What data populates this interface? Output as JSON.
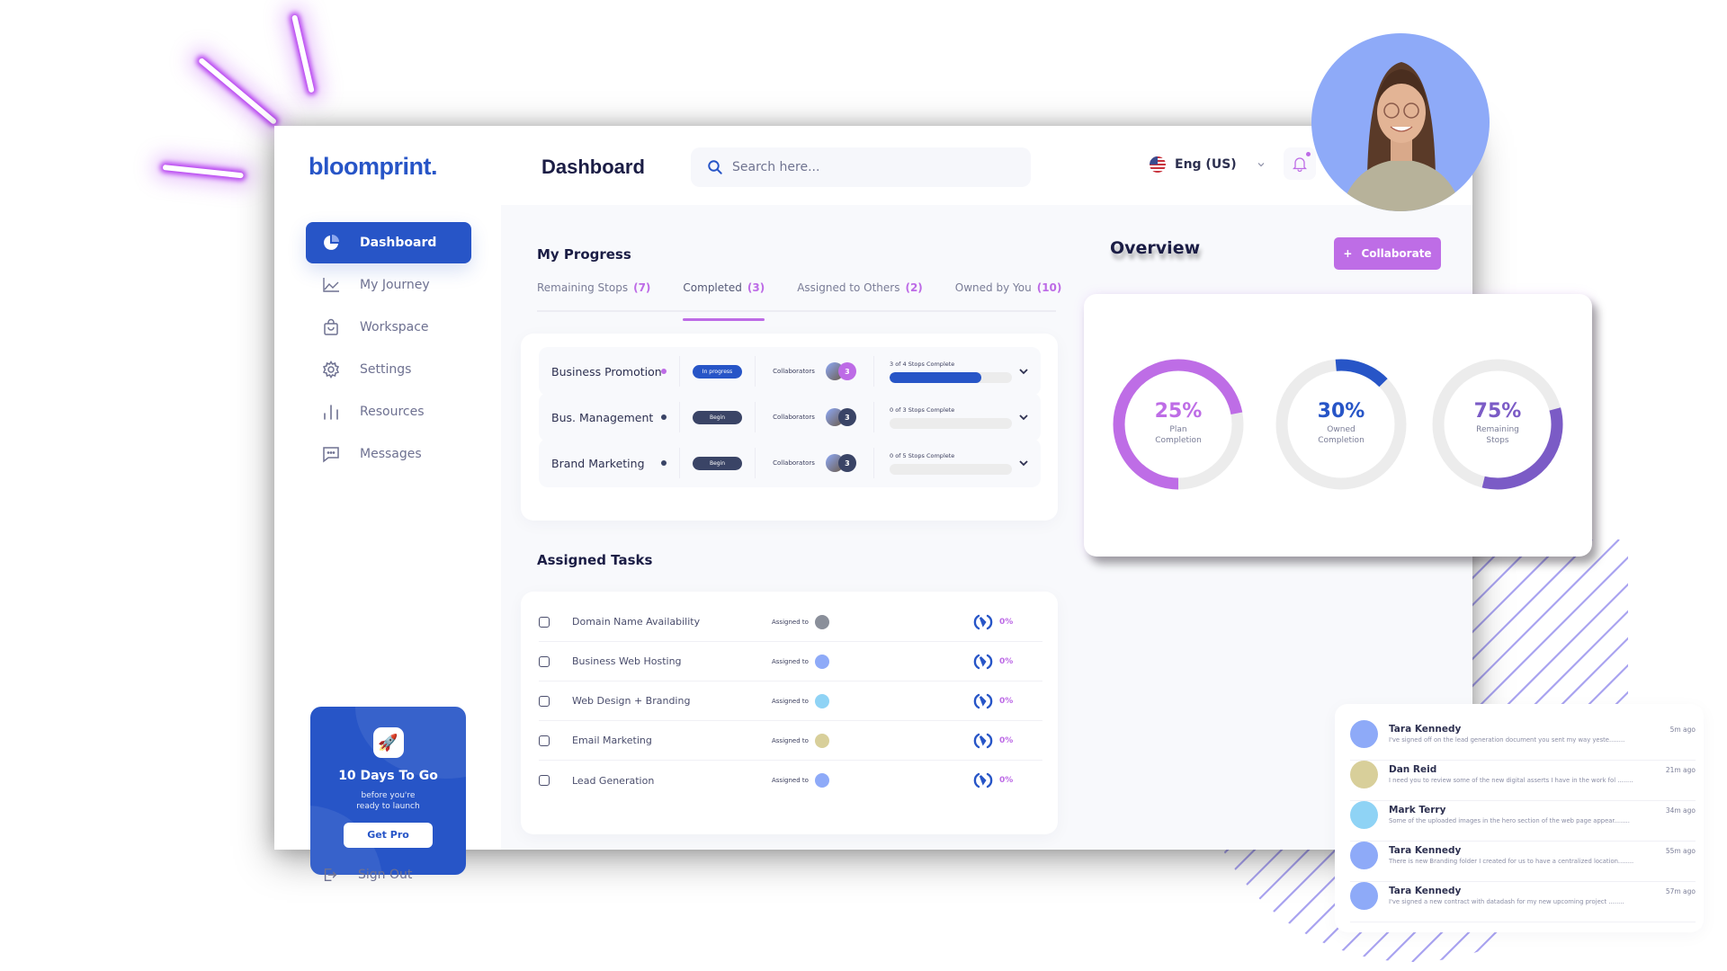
{
  "brand": {
    "name": "bloomprint.",
    "primary_color": "#2755c7",
    "accent_color": "#be6de6"
  },
  "header": {
    "title": "Dashboard",
    "search_placeholder": "Search here...",
    "language": "Eng (US)",
    "language_icon": "us-flag-icon",
    "notification_icon": "bell-icon"
  },
  "sidebar": {
    "items": [
      {
        "label": "Dashboard",
        "icon": "pie-chart-icon",
        "active": true
      },
      {
        "label": "My Journey",
        "icon": "line-chart-icon",
        "active": false
      },
      {
        "label": "Workspace",
        "icon": "shopping-bag-icon",
        "active": false
      },
      {
        "label": "Settings",
        "icon": "gear-icon",
        "active": false
      },
      {
        "label": "Resources",
        "icon": "bar-chart-icon",
        "active": false
      },
      {
        "label": "Messages",
        "icon": "message-icon",
        "active": false
      }
    ],
    "promo": {
      "icon": "rocket-icon",
      "title": "10 Days To Go",
      "subtitle_line1": "before you're",
      "subtitle_line2": "ready to launch",
      "button": "Get Pro"
    },
    "sign_out": "Sign Out"
  },
  "progress": {
    "title": "My Progress",
    "tabs": [
      {
        "label": "Remaining Stops",
        "count": "(7)",
        "active": false
      },
      {
        "label": "Completed",
        "count": "(3)",
        "active": true
      },
      {
        "label": "Assigned to Others",
        "count": "(2)",
        "active": false
      },
      {
        "label": "Owned by You",
        "count": "(10)",
        "active": false
      }
    ],
    "rows": [
      {
        "name": "Business Promotion",
        "dot_color": "#bd6be6",
        "status": "In progress",
        "status_color": "#2755c7",
        "collaborators_label": "Collaborators",
        "collaborator_count": "3",
        "count_color": "#bd6be6",
        "stops_label": "3 of 4 Stops Complete",
        "progress": 0.75
      },
      {
        "name": "Bus. Management",
        "dot_color": "#3a4466",
        "status": "Begin",
        "status_color": "#3a4466",
        "collaborators_label": "Collaborators",
        "collaborator_count": "3",
        "count_color": "#3a4466",
        "stops_label": "0 of 3 Stops Complete",
        "progress": 0
      },
      {
        "name": "Brand Marketing",
        "dot_color": "#3a4466",
        "status": "Begin",
        "status_color": "#3a4466",
        "collaborators_label": "Collaborators",
        "collaborator_count": "3",
        "count_color": "#3a4466",
        "stops_label": "0 of 5 Stops Complete",
        "progress": 0
      }
    ]
  },
  "tasks": {
    "title": "Assigned Tasks",
    "rows": [
      {
        "name": "Domain Name Availability",
        "assigned_label": "Assigned to",
        "avatar_color": "#8a8f9a",
        "percent": "0%"
      },
      {
        "name": "Business Web Hosting",
        "assigned_label": "Assigned to",
        "avatar_color": "#8eaaf8",
        "percent": "0%"
      },
      {
        "name": "Web Design + Branding",
        "assigned_label": "Assigned to",
        "avatar_color": "#8fd3f5",
        "percent": "0%"
      },
      {
        "name": "Email Marketing",
        "assigned_label": "Assigned to",
        "avatar_color": "#d8cf9a",
        "percent": "0%"
      },
      {
        "name": "Lead Generation",
        "assigned_label": "Assigned to",
        "avatar_color": "#8eaaf8",
        "percent": "0%"
      }
    ]
  },
  "overview": {
    "title": "Overview",
    "collaborate_button": "Collaborate",
    "stats": [
      {
        "value": "25%",
        "label_line1": "Plan",
        "label_line2": "Completion",
        "color": "#be6de6",
        "arc_fraction": 0.72,
        "arc_start_deg": 180
      },
      {
        "value": "30%",
        "label_line1": "Owned",
        "label_line2": "Completion",
        "color": "#2755c7",
        "arc_fraction": 0.14,
        "arc_start_deg": -5
      },
      {
        "value": "75%",
        "label_line1": "Remaining",
        "label_line2": "Stops",
        "color": "#7b5bc6",
        "arc_fraction": 0.33,
        "arc_start_deg": 75
      }
    ]
  },
  "messages": [
    {
      "name": "Tara Kennedy",
      "text": "I've signed  off  on the lead generation document you sent my way yeste........",
      "time": "5m ago",
      "avatar_color": "#8eaaf8"
    },
    {
      "name": "Dan Reid",
      "text": "I need you to review some of the new digital asserts I have in the work fol ........",
      "time": "21m ago",
      "avatar_color": "#d8cf9a"
    },
    {
      "name": "Mark Terry",
      "text": "Some of the uploaded images in the hero section of the web page appear........",
      "time": "34m ago",
      "avatar_color": "#8fd3f5"
    },
    {
      "name": "Tara Kennedy",
      "text": "There is new Branding folder I created for us to have a centralized location........",
      "time": "55m ago",
      "avatar_color": "#8eaaf8"
    },
    {
      "name": "Tara Kennedy",
      "text": "I've signed a new contract with datadash for my new upcoming project ........",
      "time": "57m ago",
      "avatar_color": "#8eaaf8"
    }
  ]
}
